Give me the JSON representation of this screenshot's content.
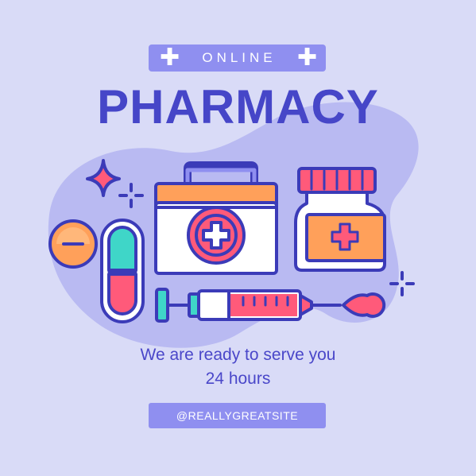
{
  "badge": {
    "label": "ONLINE"
  },
  "title": "PHARMACY",
  "tagline": {
    "line1": "We are ready to serve you",
    "line2": "24 hours"
  },
  "website": "@REALLYGREATSITE",
  "colors": {
    "background": "#d9dbf7",
    "blob": "#b9baf2",
    "accent": "#8f8ff0",
    "title": "#4646c8",
    "outline": "#3b3bb8",
    "pink": "#ff5a7a",
    "orange": "#ffa05a",
    "teal": "#3fd6c8"
  },
  "icons": [
    "sparkle-icon",
    "crosshair-plus-icon",
    "pill-tablet-icon",
    "capsule-icon",
    "first-aid-kit-icon",
    "medicine-bottle-icon",
    "syringe-icon",
    "blood-drop-icon"
  ]
}
